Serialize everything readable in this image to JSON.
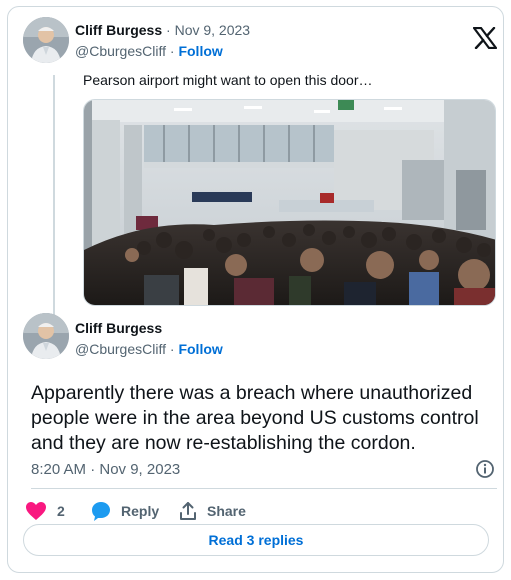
{
  "tweet_parent": {
    "author_name": "Cliff Burgess",
    "separator": "·",
    "date": "Nov 9, 2023",
    "handle": "@CburgesCliff",
    "follow_label": "Follow",
    "text": "Pearson airport might want to open this door…",
    "photo_icon": "crowded-airport-photo"
  },
  "tweet_main": {
    "author_name": "Cliff Burgess",
    "handle": "@CburgesCliff",
    "separator": "·",
    "follow_label": "Follow",
    "text": "Apparently there was a breach where unauthorized people were in the area beyond US customs control and they are now re-establishing the cordon.",
    "timestamp": "8:20 AM · Nov 9, 2023"
  },
  "actions": {
    "like_count": "2",
    "reply_label": "Reply",
    "share_label": "Share"
  },
  "read_replies_label": "Read 3 replies",
  "icons": {
    "logo": "x-logo-icon",
    "info": "info-icon",
    "like": "heart-icon",
    "reply": "speech-bubble-icon",
    "share": "share-upload-icon"
  },
  "colors": {
    "accent": "#006fd6",
    "like": "#f91880",
    "reply": "#1d9bf0",
    "muted": "#536471",
    "border": "#cfd9de"
  }
}
